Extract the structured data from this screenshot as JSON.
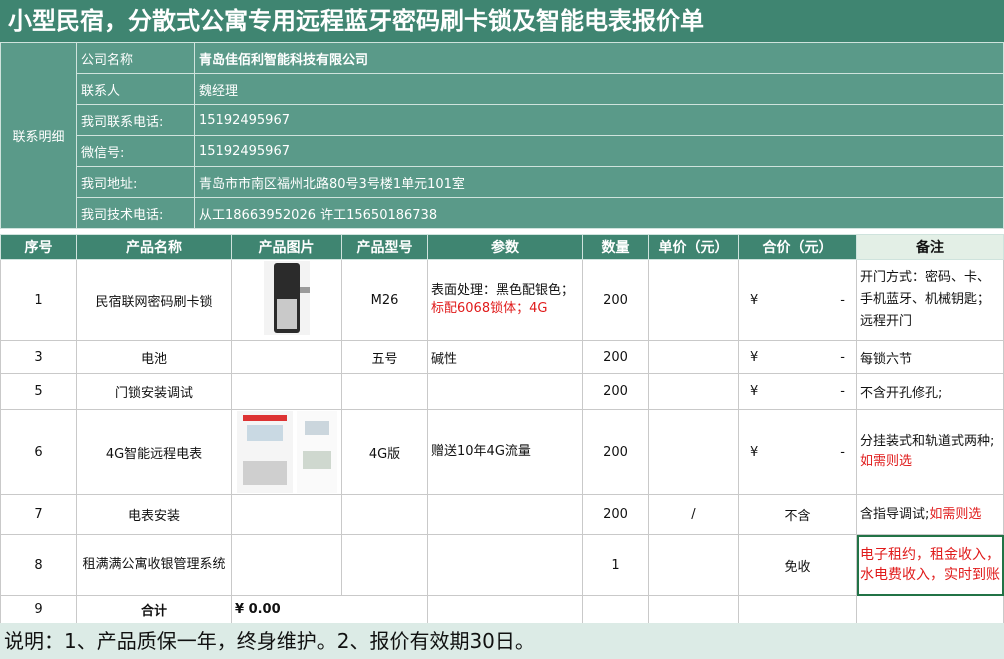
{
  "title": "小型民宿，分散式公寓专用远程蓝牙密码刷卡锁及智能电表报价单",
  "contact": {
    "group_label": "联系明细",
    "rows": [
      {
        "label": "公司名称",
        "value": "青岛佳佰利智能科技有限公司",
        "bold": true
      },
      {
        "label": "联系人",
        "value": "魏经理"
      },
      {
        "label": "我司联系电话:",
        "value": "15192495967"
      },
      {
        "label": "微信号:",
        "value": "15192495967"
      },
      {
        "label": "我司地址:",
        "value": "青岛市市南区福州北路80号3号楼1单元101室"
      },
      {
        "label": "我司技术电话:",
        "value": "从工18663952026  许工15650186738"
      }
    ]
  },
  "headers": {
    "seq": "序号",
    "name": "产品名称",
    "image": "产品图片",
    "model": "产品型号",
    "params": "参数",
    "qty": "数量",
    "unit_price": "单价（元）",
    "total": "合价（元）",
    "note": "备注"
  },
  "rows": [
    {
      "seq": "1",
      "name": "民宿联网密码刷卡锁",
      "model": "M26",
      "params_black": "表面处理：黑色配银色；",
      "params_red": "标配6068锁体；4G",
      "qty": "200",
      "yen": "¥",
      "dash": "-",
      "note": "开门方式：密码、卡、手机蓝牙、机械钥匙；      远程开门"
    },
    {
      "seq": "3",
      "name": "电池",
      "model": "五号",
      "params": "碱性",
      "qty": "200",
      "yen": "¥",
      "dash": "-",
      "note": "每锁六节"
    },
    {
      "seq": "5",
      "name": "门锁安装调试",
      "model": "",
      "params": "",
      "qty": "200",
      "yen": "¥",
      "dash": "-",
      "note": "不含开孔修孔;"
    },
    {
      "seq": "6",
      "name": "4G智能远程电表",
      "model": "4G版",
      "params": "赠送10年4G流量",
      "qty": "200",
      "yen": "¥",
      "dash": "-",
      "note_black": "分挂装式和轨道式两种;",
      "note_red": "如需则选"
    },
    {
      "seq": "7",
      "name": "电表安装",
      "qty": "200",
      "unit_price": "/",
      "total": "不含",
      "note_black": "含指导调试;",
      "note_red": "如需则选"
    },
    {
      "seq": "8",
      "name": "租满满公寓收银管理系统",
      "qty": "1",
      "total": "免收",
      "note_red": "电子租约，租金收入，水电费收入，实时到账"
    }
  ],
  "total_row": {
    "seq": "9",
    "label": "合计",
    "value": "¥ 0.00"
  },
  "footer": "说明：1、产品质保一年，终身维护。2、报价有效期30日。"
}
